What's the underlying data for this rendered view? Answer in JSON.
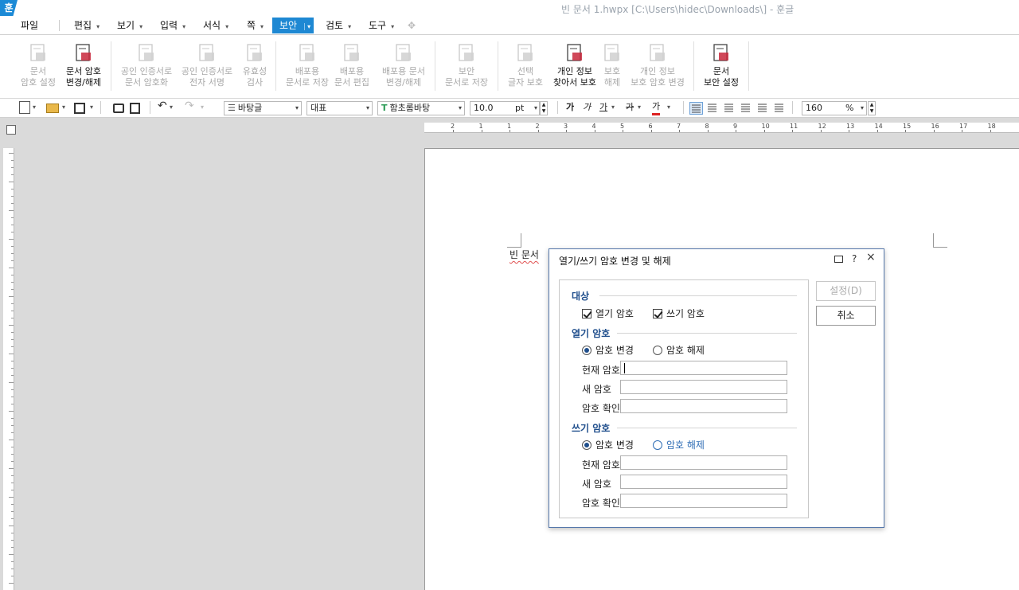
{
  "window": {
    "title": "빈 문서 1.hwpx [C:\\Users\\hidec\\Downloads\\] - 훈글",
    "logo": "훈"
  },
  "menu": {
    "file": "파일",
    "items": [
      {
        "label": "편집"
      },
      {
        "label": "보기"
      },
      {
        "label": "입력"
      },
      {
        "label": "서식"
      },
      {
        "label": "쪽"
      },
      {
        "label": "보안"
      },
      {
        "label": "검토"
      },
      {
        "label": "도구"
      }
    ],
    "active": "보안"
  },
  "ribbon": [
    {
      "line1": "문서",
      "line2": "암호 설정",
      "enabled": false,
      "icon": "document-lock-icon"
    },
    {
      "line1": "문서 암호",
      "line2": "변경/해제",
      "enabled": true,
      "icon": "document-password-change-icon"
    },
    {
      "line1": "공인 인증서로",
      "line2": "문서 암호화",
      "enabled": false,
      "icon": "certificate-encrypt-icon"
    },
    {
      "line1": "공인 인증서로",
      "line2": "전자 서명",
      "enabled": false,
      "icon": "certificate-sign-icon"
    },
    {
      "line1": "유효성",
      "line2": "검사",
      "enabled": false,
      "icon": "validity-check-icon"
    },
    {
      "line1": "배포용",
      "line2": "문서로 저장",
      "enabled": false,
      "icon": "distribution-save-icon"
    },
    {
      "line1": "배포용",
      "line2": "문서 편집",
      "enabled": false,
      "icon": "distribution-edit-icon"
    },
    {
      "line1": "배포용 문서",
      "line2": "변경/해제",
      "enabled": false,
      "icon": "distribution-change-icon"
    },
    {
      "line1": "보안",
      "line2": "문서로 저장",
      "enabled": false,
      "icon": "secure-save-icon"
    },
    {
      "line1": "선택",
      "line2": "글자 보호",
      "enabled": false,
      "icon": "select-text-protect-icon"
    },
    {
      "line1": "개인 정보",
      "line2": "찾아서 보호",
      "enabled": true,
      "icon": "find-personal-info-icon"
    },
    {
      "line1": "보호",
      "line2": "해제",
      "enabled": false,
      "icon": "unprotect-icon"
    },
    {
      "line1": "개인 정보",
      "line2": "보호 암호 변경",
      "enabled": false,
      "icon": "personal-info-password-icon"
    },
    {
      "line1": "문서",
      "line2": "보안 설정",
      "enabled": true,
      "icon": "document-security-settings-icon"
    }
  ],
  "toolbar": {
    "style": "바탕글",
    "lang": "대표",
    "font": "함초롬바탕",
    "size": "10.0",
    "unit": "pt",
    "zoom": "160",
    "zoom_unit": "%",
    "char_bold": "가",
    "char_italic": "가",
    "char_underline": "가",
    "char_strike": "가",
    "char_color": "가",
    "font_icon": "T"
  },
  "ruler": {
    "h_ticks": [
      "2",
      "1",
      "1",
      "2",
      "3",
      "4",
      "5",
      "6",
      "7",
      "8",
      "9",
      "10",
      "11",
      "12",
      "13",
      "14",
      "15",
      "16",
      "17",
      "18"
    ]
  },
  "document": {
    "text": "빈 문서"
  },
  "dialog": {
    "title": "열기/쓰기 암호 변경 및 해제",
    "target_section": "대상",
    "open_pw_check": "열기 암호",
    "write_pw_check": "쓰기 암호",
    "open_section": "열기 암호",
    "write_section": "쓰기 암호",
    "change": "암호 변경",
    "remove": "암호 해제",
    "current_pw": "현재 암호",
    "new_pw": "새 암호",
    "confirm_pw": "암호 확인",
    "set_button": "설정(D)",
    "cancel_button": "취소",
    "help": "?",
    "close": "×"
  }
}
